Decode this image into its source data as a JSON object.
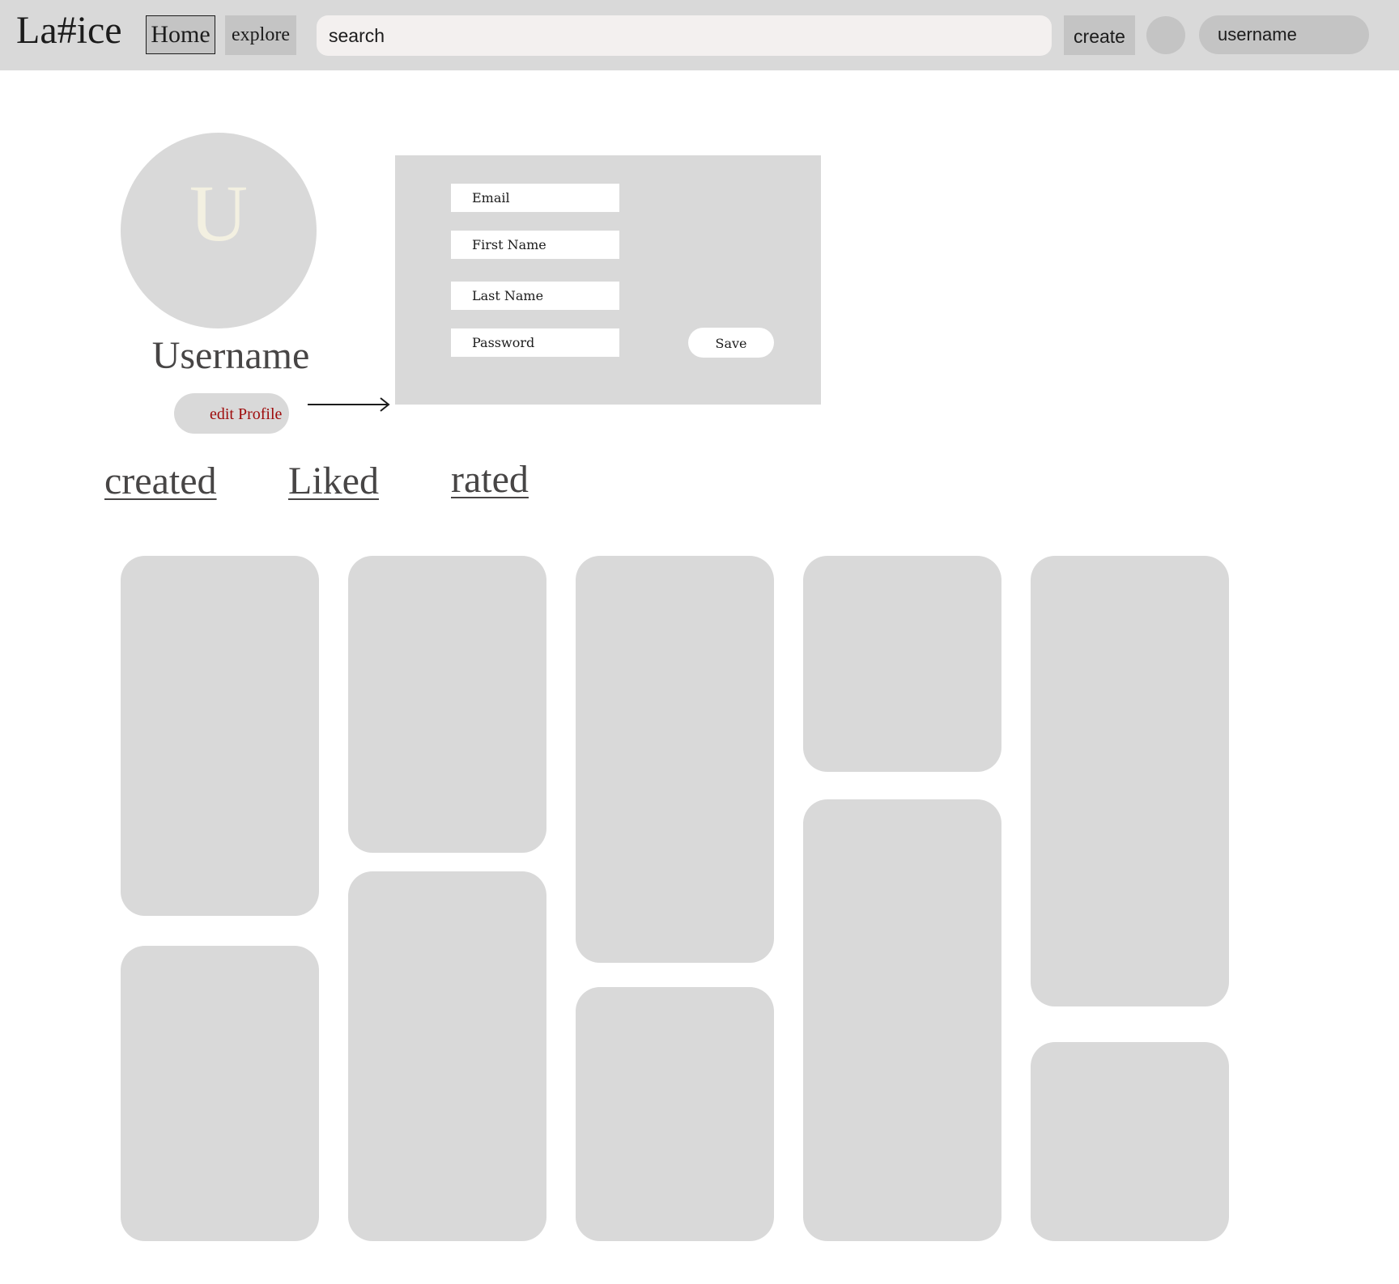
{
  "header": {
    "logo": "La#ice",
    "nav": {
      "home_label": "Home",
      "explore_label": "explore"
    },
    "search": {
      "placeholder": "search"
    },
    "create_label": "create",
    "user_label": "username"
  },
  "profile": {
    "avatar_initial": "U",
    "name": "Username",
    "edit_label": "edit Profile"
  },
  "edit_panel": {
    "email_label": "Email",
    "first_name_label": "First Name",
    "last_name_label": "Last Name",
    "password_label": "Password",
    "save_label": "Save"
  },
  "tabs": [
    "created",
    "Liked",
    "rated"
  ],
  "colors": {
    "topbar": "#d9d9d9",
    "button": "#c4c4c4",
    "card": "#d9d9d9",
    "edit_text": "#9e0b0b",
    "heading_text": "#474545"
  }
}
